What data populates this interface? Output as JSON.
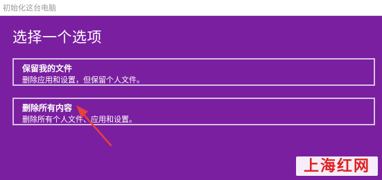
{
  "window": {
    "title": "初始化这台电脑"
  },
  "dialog": {
    "heading": "选择一个选项",
    "options": [
      {
        "title": "保留我的文件",
        "description": "删除应用和设置，但保留个人文件。"
      },
      {
        "title": "删除所有内容",
        "description": "删除所有个人文件、应用和设置。"
      }
    ]
  },
  "annotation": {
    "arrow_color": "#e8403a",
    "icon": "pointer-arrow-icon"
  },
  "watermark": {
    "text": "上海红网"
  },
  "colors": {
    "background": "#7a1fa0",
    "option_border": "#d8bfe6",
    "watermark_red": "#e02020"
  }
}
